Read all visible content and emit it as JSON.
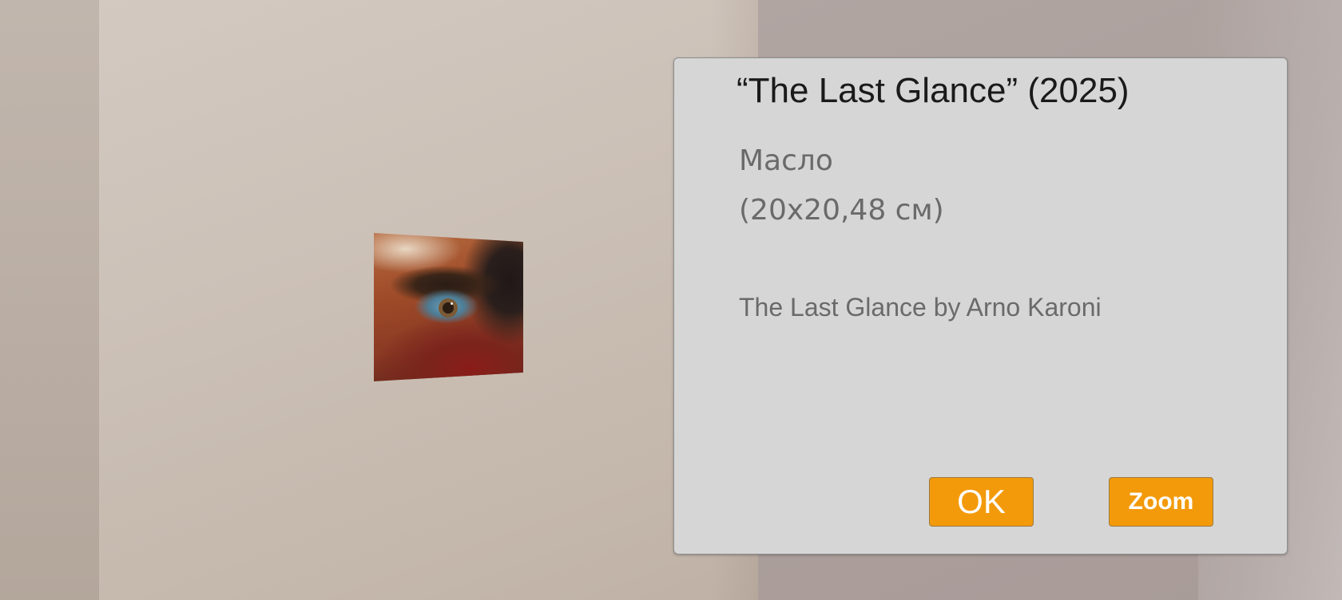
{
  "artwork": {
    "title": "“The Last Glance” (2025)",
    "medium": "Масло",
    "dimensions": "(20x20,48 см)",
    "description": "The Last Glance by Arno Karoni"
  },
  "buttons": {
    "ok_label": "OK",
    "zoom_label": "Zoom"
  },
  "colors": {
    "dialog_background": "#d6d6d6",
    "button_accent": "#f39a0b"
  }
}
